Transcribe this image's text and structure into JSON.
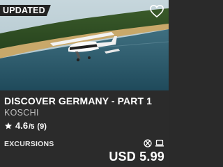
{
  "card": {
    "badge": "UPDATED",
    "title": "DISCOVER GERMANY - PART 1",
    "publisher": "KOSCHI",
    "rating": {
      "value": "4.6",
      "out_of": "/5",
      "count": "(9)"
    },
    "category": "EXCURSIONS",
    "price": "USD 5.99",
    "platforms": [
      "xbox-icon",
      "pc-laptop-icon"
    ],
    "icons": {
      "wishlist": "heart-outline-icon",
      "star": "star-icon"
    },
    "colors": {
      "background": "#2b2b2b",
      "badge": "#222222",
      "text": "#ffffff",
      "muted": "#bfbfbf"
    }
  }
}
